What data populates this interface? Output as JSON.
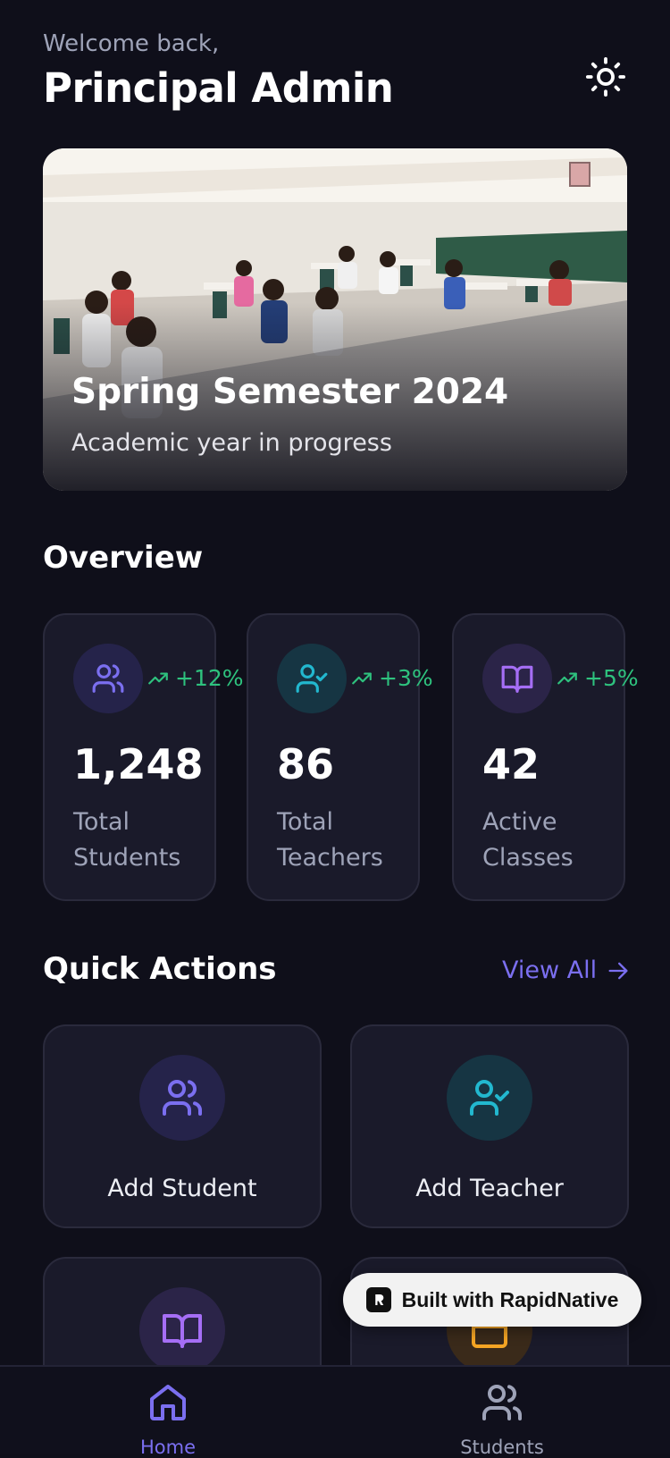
{
  "header": {
    "welcome": "Welcome back,",
    "name": "Principal Admin",
    "theme_icon": "sun-icon"
  },
  "hero": {
    "title": "Spring Semester 2024",
    "subtitle": "Academic year in progress"
  },
  "overview": {
    "title": "Overview",
    "stats": [
      {
        "icon": "users-icon",
        "trend": "+12%",
        "value": "1,248",
        "label": "Total Students",
        "color": "#7b6ff0",
        "bg": "#25234a"
      },
      {
        "icon": "user-check-icon",
        "trend": "+3%",
        "value": "86",
        "label": "Total Teachers",
        "color": "#22b8cf",
        "bg": "#163543"
      },
      {
        "icon": "book-open-icon",
        "trend": "+5%",
        "value": "42",
        "label": "Active Classes",
        "color": "#a56ef5",
        "bg": "#2b2448"
      }
    ]
  },
  "quick_actions": {
    "title": "Quick Actions",
    "view_all": "View All",
    "items": [
      {
        "label": "Add Student",
        "icon": "users-icon"
      },
      {
        "label": "Add Teacher",
        "icon": "user-check-icon"
      }
    ]
  },
  "badge": {
    "text": "Built with RapidNative"
  },
  "tabbar": {
    "tabs": [
      {
        "label": "Home",
        "icon": "home-icon",
        "active": true
      },
      {
        "label": "Students",
        "icon": "users-icon",
        "active": false
      }
    ]
  },
  "colors": {
    "accent": "#7b6ff0",
    "trend": "#2ec27e",
    "background": "#0f0f1a",
    "card": "#1a1a2a"
  }
}
